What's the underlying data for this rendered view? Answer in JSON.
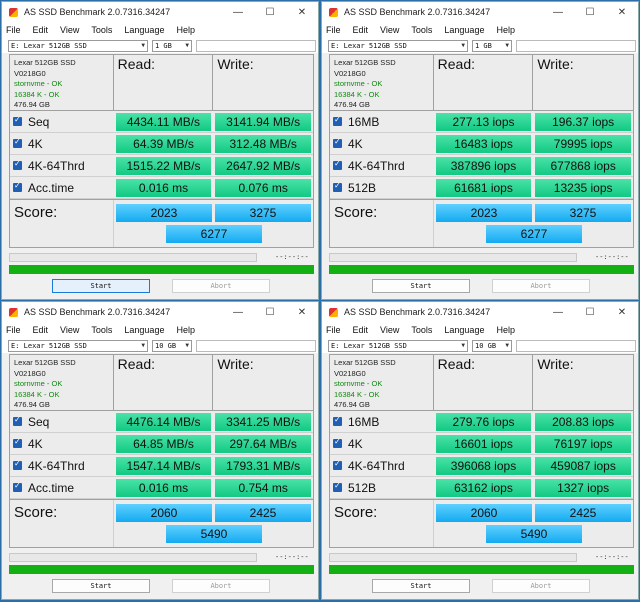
{
  "app_title": "AS SSD Benchmark 2.0.7316.34247",
  "menu": [
    "File",
    "Edit",
    "View",
    "Tools",
    "Language",
    "Help"
  ],
  "window_controls": [
    "—",
    "☐",
    "✕"
  ],
  "labels": {
    "read": "Read:",
    "write": "Write:",
    "score": "Score:",
    "start": "Start",
    "abort": "Abort",
    "elapsed": "--:--:--"
  },
  "drive": {
    "select": "E: Lexar 512GB SSD",
    "name": "Lexar 512GB SSD",
    "firmware": "V0218G0",
    "driver": "stornvme - OK",
    "alignment": "16384 K - OK",
    "capacity": "476.94 GB"
  },
  "windows": [
    {
      "size": "1 GB",
      "rows": [
        {
          "label": "Seq",
          "read": "4434.11 MB/s",
          "write": "3141.94 MB/s"
        },
        {
          "label": "4K",
          "read": "64.39 MB/s",
          "write": "312.48 MB/s"
        },
        {
          "label": "4K-64Thrd",
          "read": "1515.22 MB/s",
          "write": "2647.92 MB/s"
        },
        {
          "label": "Acc.time",
          "read": "0.016 ms",
          "write": "0.076 ms"
        }
      ],
      "score_read": "2023",
      "score_write": "3275",
      "score_total": "6277"
    },
    {
      "size": "1 GB",
      "rows": [
        {
          "label": "16MB",
          "read": "277.13 iops",
          "write": "196.37 iops"
        },
        {
          "label": "4K",
          "read": "16483 iops",
          "write": "79995 iops"
        },
        {
          "label": "4K-64Thrd",
          "read": "387896 iops",
          "write": "677868 iops"
        },
        {
          "label": "512B",
          "read": "61681 iops",
          "write": "13235 iops"
        }
      ],
      "score_read": "2023",
      "score_write": "3275",
      "score_total": "6277"
    },
    {
      "size": "10 GB",
      "rows": [
        {
          "label": "Seq",
          "read": "4476.14 MB/s",
          "write": "3341.25 MB/s"
        },
        {
          "label": "4K",
          "read": "64.85 MB/s",
          "write": "297.64 MB/s"
        },
        {
          "label": "4K-64Thrd",
          "read": "1547.14 MB/s",
          "write": "1793.31 MB/s"
        },
        {
          "label": "Acc.time",
          "read": "0.016 ms",
          "write": "0.754 ms"
        }
      ],
      "score_read": "2060",
      "score_write": "2425",
      "score_total": "5490"
    },
    {
      "size": "10 GB",
      "rows": [
        {
          "label": "16MB",
          "read": "279.76 iops",
          "write": "208.83 iops"
        },
        {
          "label": "4K",
          "read": "16601 iops",
          "write": "76197 iops"
        },
        {
          "label": "4K-64Thrd",
          "read": "396068 iops",
          "write": "459087 iops"
        },
        {
          "label": "512B",
          "read": "63162 iops",
          "write": "1327 iops"
        }
      ],
      "score_read": "2060",
      "score_write": "2425",
      "score_total": "5490"
    }
  ]
}
